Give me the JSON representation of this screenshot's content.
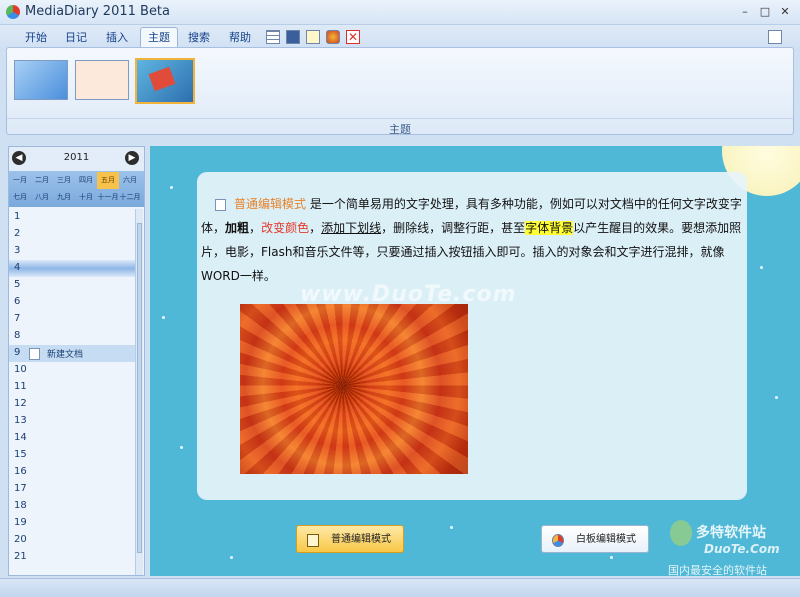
{
  "window": {
    "title": "MediaDiary 2011 Beta",
    "controls": {
      "minimize": "–",
      "maximize": "□",
      "close": "✕"
    }
  },
  "menu": {
    "items": [
      "开始",
      "日记",
      "插入",
      "主题",
      "搜索",
      "帮助"
    ],
    "active": "主题"
  },
  "ribbon": {
    "group_label": "主题",
    "themes": [
      {
        "name": "blue-sky",
        "color": "#6aa9e6"
      },
      {
        "name": "peach",
        "color": "#fbe3d6"
      },
      {
        "name": "gift",
        "color": "#2c8fc9",
        "selected": true
      }
    ]
  },
  "calendar": {
    "prev": "◀",
    "next": "▶",
    "year": "2011",
    "months": [
      "一月",
      "二月",
      "三月",
      "四月",
      "五月",
      "六月",
      "七月",
      "八月",
      "九月",
      "十月",
      "十一月",
      "十二月"
    ],
    "selected_month": "五月",
    "days": [
      "1",
      "2",
      "3",
      "4",
      "5",
      "6",
      "7",
      "8",
      "9",
      "10",
      "11",
      "12",
      "13",
      "14",
      "15",
      "16",
      "17",
      "18",
      "19",
      "20",
      "21"
    ],
    "today": "4",
    "doc_day": "9",
    "doc_title": "新建文档"
  },
  "document": {
    "mode_title": "普通编辑模式",
    "text_1": "是一个简单易用的文字处理，具有多种功能，例如可以对文档中的任何文字",
    "text_font_change": "改变字体",
    "sep_1": "，",
    "text_bold": "加粗",
    "sep_2": "，",
    "text_color": "改变颜色",
    "sep_3": "，",
    "text_underline": "添加下划线",
    "text_2": "，删除线，调整行距，甚至",
    "text_bg": "字体背景",
    "text_3": "以产生醒目的效果。要想添加照片，电影，Flash和音乐文件等，只要通过插入按钮插入即可。插入的对象会和文字进行混排，就像WORD一样。"
  },
  "watermark": "www.DuoTe.com",
  "buttons": {
    "normal_mode": "普通编辑模式",
    "whiteboard_mode": "白板编辑模式"
  },
  "brand": {
    "name": "多特软件站",
    "site": "DuoTe.Com",
    "slogan": "国内最安全的软件站"
  }
}
